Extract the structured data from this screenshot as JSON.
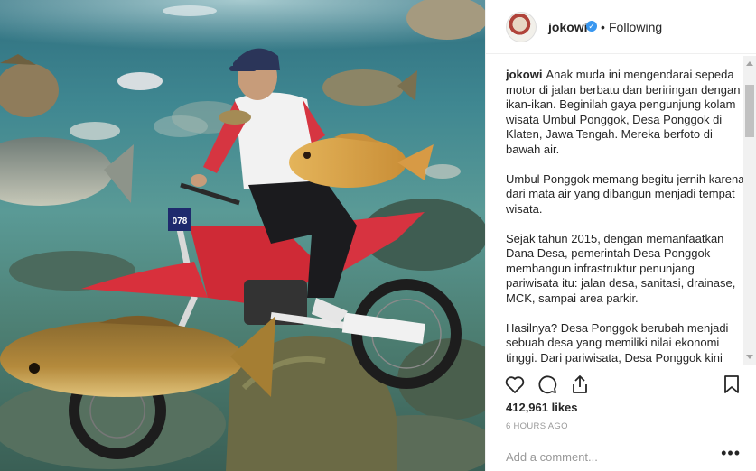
{
  "post": {
    "username": "jokowi",
    "separator": "•",
    "follow_status": "Following",
    "verified_mark": "✓",
    "caption_user": "jokowi",
    "caption_paragraphs": [
      "Anak muda ini mengendarai sepeda motor di jalan berbatu dan beriringan dengan ikan-ikan. Beginilah gaya pengunjung kolam wisata Umbul Ponggok, Desa Ponggok di Klaten, Jawa Tengah. Mereka berfoto di bawah air.",
      "Umbul Ponggok memang begitu jernih karena dari mata air yang dibangun menjadi tempat wisata.",
      "Sejak tahun 2015, dengan memanfaatkan Dana Desa, pemerintah Desa Ponggok membangun infrastruktur penunjang pariwisata itu: jalan desa, sanitasi, drainase, MCK, sampai area parkir.",
      "Hasilnya? Desa Ponggok berubah menjadi sebuah desa yang memiliki nilai ekonomi tinggi. Dari pariwisata, Desa Ponggok kini bisa mendapatkan penghasilan sampai"
    ],
    "likes": "412,961 likes",
    "timestamp": "6 HOURS AGO",
    "photo_number_plate": "078"
  },
  "comment": {
    "placeholder": "Add a comment...",
    "more": "•••"
  },
  "icons": {
    "like": "heart-icon",
    "comment": "comment-icon",
    "share": "share-icon",
    "save": "bookmark-icon"
  },
  "colors": {
    "verified": "#3897f0",
    "text": "#262626",
    "muted": "#999999"
  }
}
